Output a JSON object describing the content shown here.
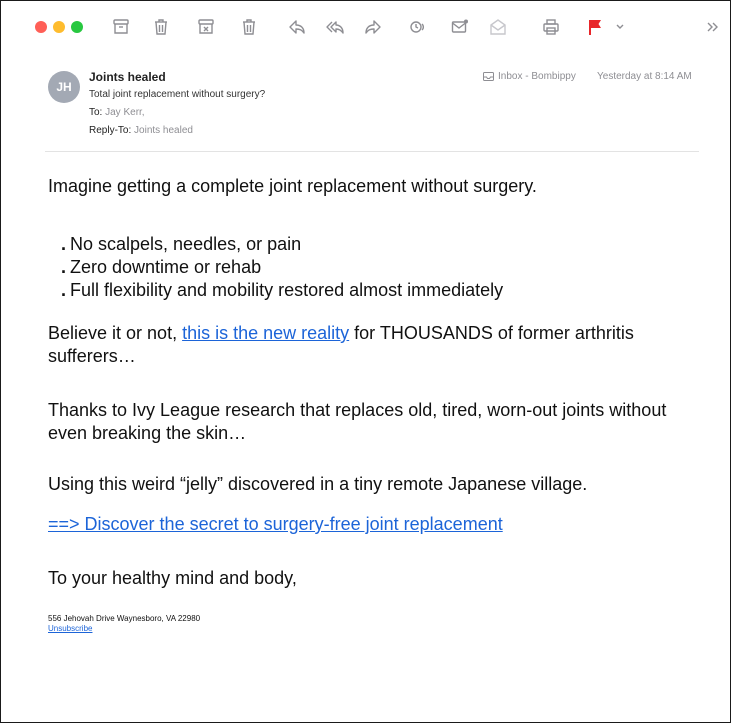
{
  "toolbar": {
    "icons": [
      "archive-icon",
      "trash-icon",
      "junk-icon",
      "delete-icon",
      "reply-icon",
      "reply-all-icon",
      "forward-icon",
      "mute-icon",
      "mark-unread-icon",
      "read-icon",
      "print-icon",
      "flag-icon",
      "chevron-down-icon",
      "overflow-icon"
    ],
    "flag_color": "#e8262a"
  },
  "header": {
    "avatar_initials": "JH",
    "sender": "Joints healed",
    "subject": "Total joint replacement without surgery?",
    "to_label": "To:",
    "to_value": "Jay Kerr,",
    "reply_to_label": "Reply-To:",
    "reply_to_value": "Joints healed",
    "mailbox": "Inbox - Bombippy",
    "date": "Yesterday at 8:14 AM"
  },
  "body": {
    "intro": "Imagine getting a complete joint replacement without surgery.",
    "bullets": [
      "No scalpels, needles, or pain",
      "Zero downtime or rehab",
      "Full flexibility and mobility restored almost immediately"
    ],
    "p1_before": "Believe it or not, ",
    "p1_link": "this is the new reality",
    "p1_after": " for THOUSANDS of former arthritis sufferers…",
    "p2": "Thanks to Ivy League research that replaces old, tired, worn-out joints without even breaking the skin…",
    "p3": "Using this weird “jelly” discovered in a tiny remote Japanese village.",
    "cta_link": "==> Discover the secret to surgery-free joint replacement",
    "sign_off": "To your healthy mind and body,",
    "footer_address": "556 Jehovah Drive Waynesboro, VA 22980",
    "unsubscribe": "Unsubscribe"
  },
  "colors": {
    "link": "#1c64d8",
    "avatar": "#a3a9b4",
    "traffic_red": "#ff5f57",
    "traffic_yellow": "#febc2e",
    "traffic_green": "#28c840"
  }
}
